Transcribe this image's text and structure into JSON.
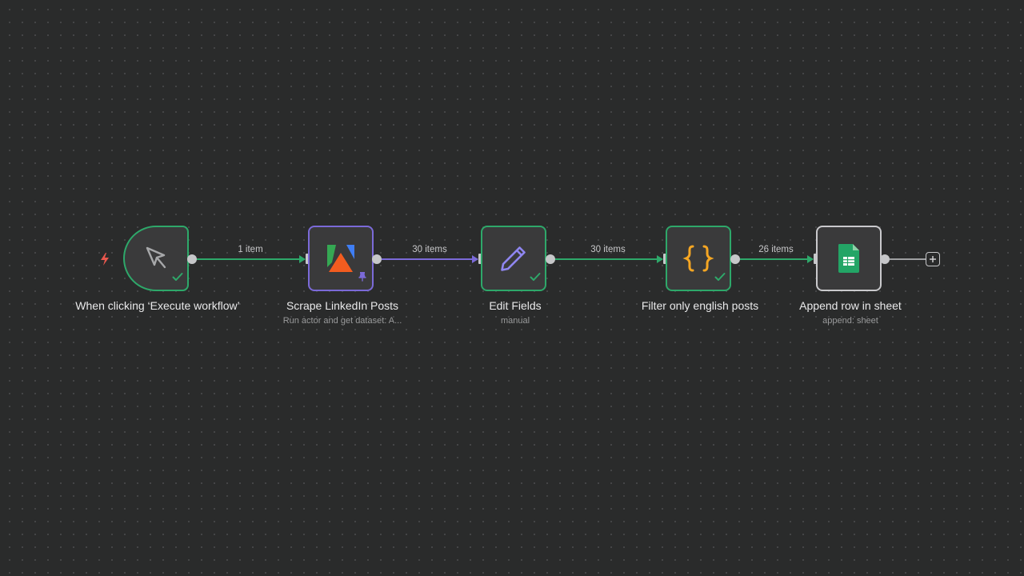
{
  "nodes": [
    {
      "id": "manual-trigger",
      "title": "When clicking ‘Execute workflow’",
      "subtitle": "",
      "icon": "cursor-icon",
      "status": "success"
    },
    {
      "id": "scrape-linkedin",
      "title": "Scrape LinkedIn Posts",
      "subtitle": "Run actor and get dataset: A...",
      "icon": "apify-logo-icon",
      "status": "pinned"
    },
    {
      "id": "edit-fields",
      "title": "Edit Fields",
      "subtitle": "manual",
      "icon": "pencil-icon",
      "status": "success"
    },
    {
      "id": "filter-english",
      "title": "Filter only english posts",
      "subtitle": "",
      "icon": "code-braces-icon",
      "status": "success"
    },
    {
      "id": "append-row",
      "title": "Append row in sheet",
      "subtitle": "append: sheet",
      "icon": "google-sheets-icon",
      "status": "idle"
    }
  ],
  "connections": [
    {
      "from": "manual-trigger",
      "to": "scrape-linkedin",
      "label": "1 item"
    },
    {
      "from": "scrape-linkedin",
      "to": "edit-fields",
      "label": "30 items"
    },
    {
      "from": "edit-fields",
      "to": "filter-english",
      "label": "30 items"
    },
    {
      "from": "filter-english",
      "to": "append-row",
      "label": "26 items"
    }
  ],
  "colors": {
    "canvas": "#2a2b2b",
    "node_fill": "#3a3a3b",
    "success": "#2ea86a",
    "pinned": "#7b6ad8",
    "idle_border": "#c9c9cc",
    "trigger_bolt": "#e8574d",
    "braces": "#f5a623",
    "sheets_green": "#23a566"
  }
}
